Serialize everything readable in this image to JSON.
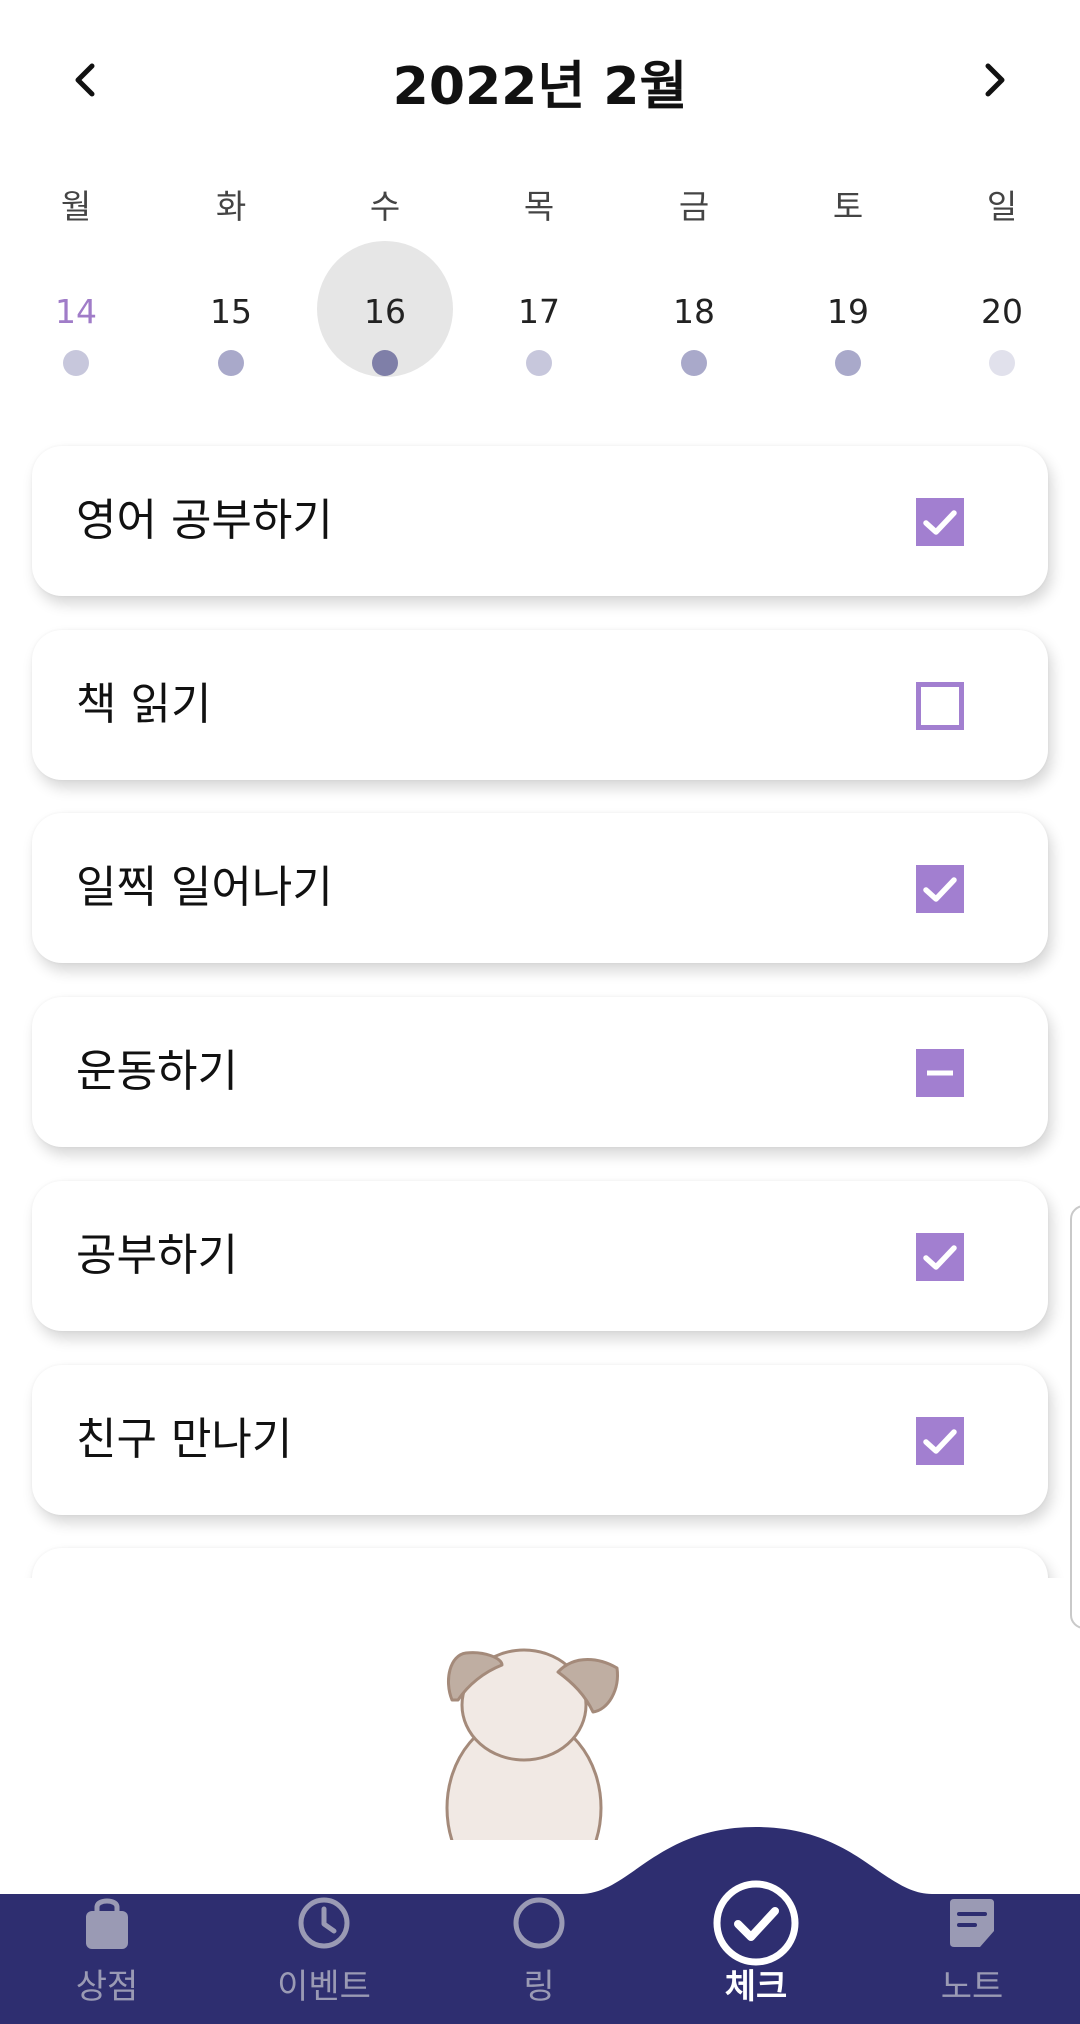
{
  "header": {
    "title": "2022년 2월",
    "prev_icon": "chevron-left-icon",
    "next_icon": "chevron-right-icon"
  },
  "week": {
    "days": [
      {
        "weekday": "월",
        "date": "14",
        "dot_color": "#c7c7dc",
        "today": true
      },
      {
        "weekday": "화",
        "date": "15",
        "dot_color": "#a9a9ca"
      },
      {
        "weekday": "수",
        "date": "16",
        "dot_color": "#7f7fa8",
        "selected": true
      },
      {
        "weekday": "목",
        "date": "17",
        "dot_color": "#c7c7dc"
      },
      {
        "weekday": "금",
        "date": "18",
        "dot_color": "#a9a9ca"
      },
      {
        "weekday": "토",
        "date": "19",
        "dot_color": "#a9a9ca"
      },
      {
        "weekday": "일",
        "date": "20",
        "dot_color": "#e1e1ec"
      }
    ]
  },
  "tasks": [
    {
      "label": "영어 공부하기",
      "status": "checked"
    },
    {
      "label": "책 읽기",
      "status": "empty"
    },
    {
      "label": "일찍 일어나기",
      "status": "checked"
    },
    {
      "label": "운동하기",
      "status": "partial"
    },
    {
      "label": "공부하기",
      "status": "checked"
    },
    {
      "label": "친구 만나기",
      "status": "checked"
    },
    {
      "label": "",
      "status": "hidden"
    }
  ],
  "tabs": [
    {
      "label": "상점",
      "icon": "shopping-bag-icon"
    },
    {
      "label": "이벤트",
      "icon": "clock-icon"
    },
    {
      "label": "링",
      "icon": "ring-icon"
    },
    {
      "label": "체크",
      "icon": "check-circle-icon",
      "active": true
    },
    {
      "label": "노트",
      "icon": "note-icon"
    }
  ],
  "colors": {
    "accent": "#a27fd0",
    "navbar": "#2e2e70",
    "today": "#a07cc8"
  }
}
